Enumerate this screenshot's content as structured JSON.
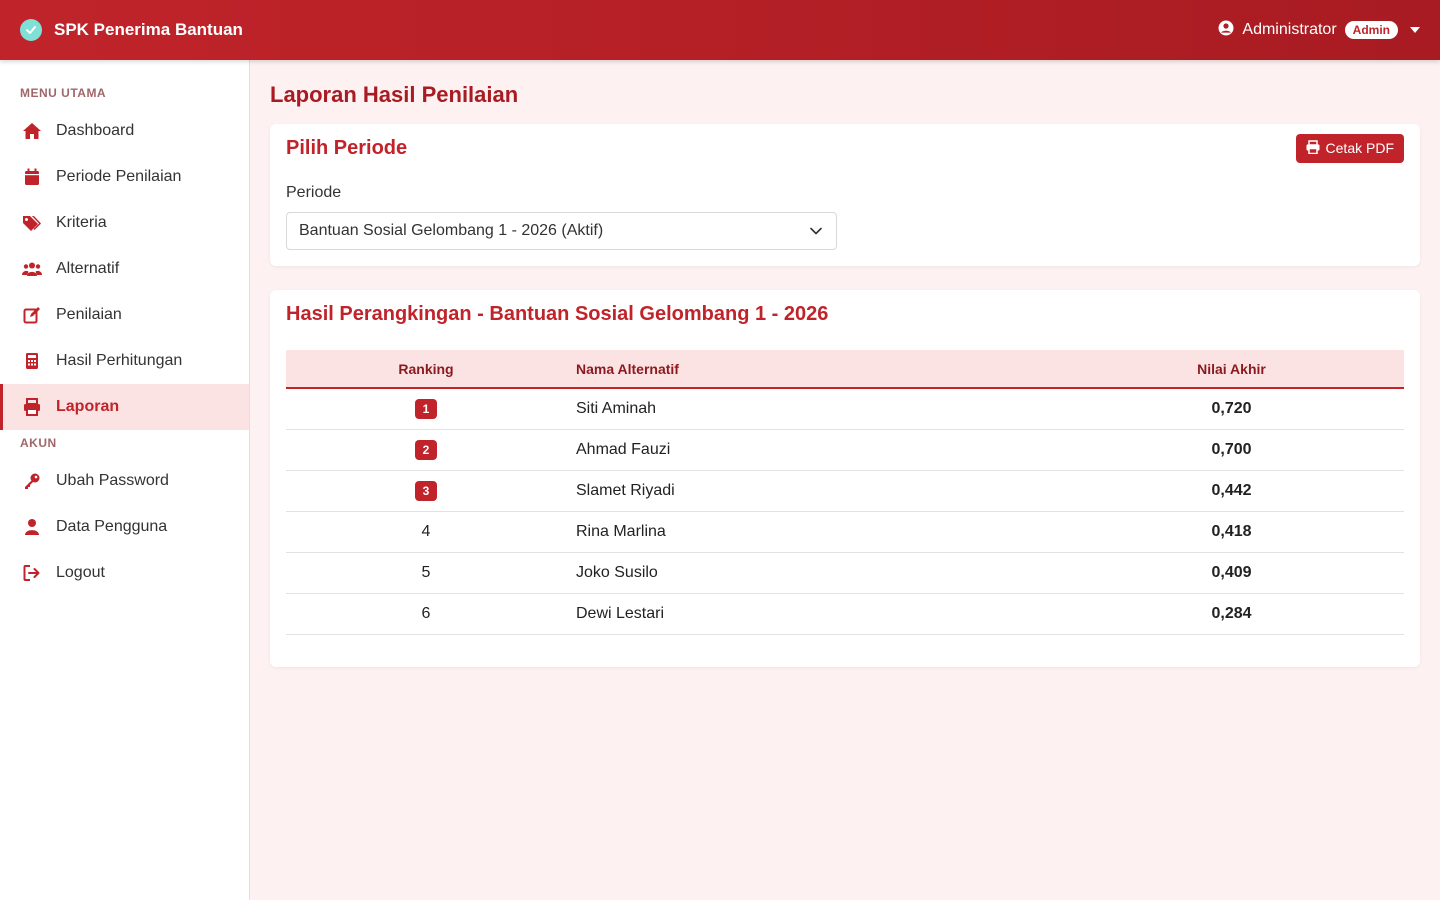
{
  "app": {
    "title": "SPK Penerima Bantuan"
  },
  "user": {
    "name": "Administrator",
    "role": "Admin"
  },
  "sidebar": {
    "section_main": "MENU UTAMA",
    "items": [
      {
        "label": "Dashboard",
        "icon": "home-icon"
      },
      {
        "label": "Periode Penilaian",
        "icon": "calendar-icon"
      },
      {
        "label": "Kriteria",
        "icon": "tags-icon"
      },
      {
        "label": "Alternatif",
        "icon": "users-icon"
      },
      {
        "label": "Penilaian",
        "icon": "edit-icon"
      },
      {
        "label": "Hasil Perhitungan",
        "icon": "calculator-icon"
      },
      {
        "label": "Laporan",
        "icon": "printer-icon",
        "active": true
      }
    ],
    "section_account": "AKUN",
    "account_items": [
      {
        "label": "Ubah Password",
        "icon": "key-icon"
      },
      {
        "label": "Data Pengguna",
        "icon": "user-icon"
      },
      {
        "label": "Logout",
        "icon": "logout-icon"
      }
    ]
  },
  "page": {
    "title": "Laporan Hasil Penilaian"
  },
  "periode_card": {
    "title": "Pilih Periode",
    "print_button": "Cetak PDF",
    "field_label": "Periode",
    "selected": "Bantuan Sosial Gelombang 1 - 2026 (Aktif)"
  },
  "results_card": {
    "title": "Hasil Perangkingan - Bantuan Sosial Gelombang 1 - 2026",
    "headers": {
      "rank": "Ranking",
      "name": "Nama Alternatif",
      "score": "Nilai Akhir"
    },
    "rows": [
      {
        "rank": "1",
        "name": "Siti Aminah",
        "score": "0,720"
      },
      {
        "rank": "2",
        "name": "Ahmad Fauzi",
        "score": "0,700"
      },
      {
        "rank": "3",
        "name": "Slamet Riyadi",
        "score": "0,442"
      },
      {
        "rank": "4",
        "name": "Rina Marlina",
        "score": "0,418"
      },
      {
        "rank": "5",
        "name": "Joko Susilo",
        "score": "0,409"
      },
      {
        "rank": "6",
        "name": "Dewi Lestari",
        "score": "0,284"
      }
    ]
  },
  "colors": {
    "primary": "#c0242a",
    "primary_dark": "#a81b22",
    "background": "#fdf1f1",
    "highlight": "#fbe3e3"
  }
}
